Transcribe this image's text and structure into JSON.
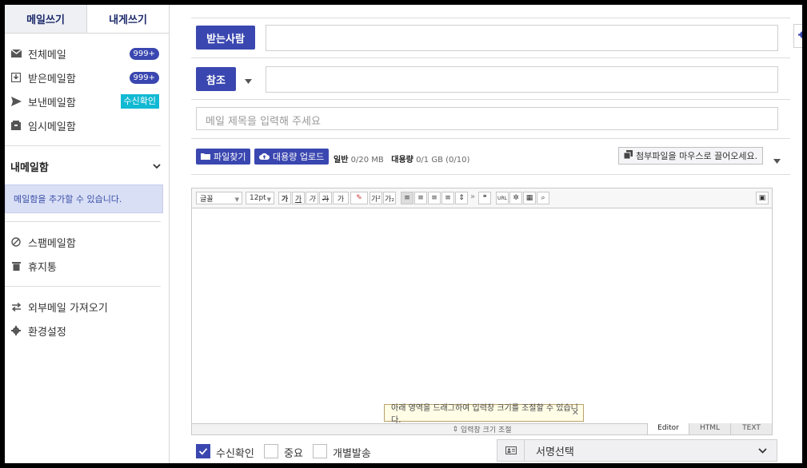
{
  "tabs": {
    "write": "메일쓰기",
    "self": "내게쓰기"
  },
  "nav": [
    {
      "label": "전체메일",
      "icon": "mail-icon",
      "badge": "999+"
    },
    {
      "label": "받은메일함",
      "icon": "inbox-icon",
      "badge": "999+"
    },
    {
      "label": "보낸메일함",
      "icon": "send-icon",
      "badge": "수신확인"
    },
    {
      "label": "임시메일함",
      "icon": "draft-icon",
      "badge": ""
    }
  ],
  "mybox": {
    "title": "내메일함",
    "hint": "메일함을 추가할 수 있습니다."
  },
  "nav2": [
    {
      "label": "스팸메일함",
      "icon": "spam-icon"
    },
    {
      "label": "휴지통",
      "icon": "trash-icon"
    }
  ],
  "nav3": [
    {
      "label": "외부메일 가져오기",
      "icon": "import-icon"
    },
    {
      "label": "환경설정",
      "icon": "gear-icon"
    }
  ],
  "compose": {
    "to_label": "받는사람",
    "to_value": "",
    "cc_label": "참조",
    "cc_value": "",
    "subject_placeholder": "메일 제목을 입력해 주세요",
    "attach_btn": "파일찾기",
    "bulk_btn": "대용량 업로드",
    "quota_normal_label": "일반",
    "quota_normal_value": "0/20 MB",
    "quota_bulk_label": "대용량",
    "quota_bulk_value": "0/1 GB (0/10)",
    "drop_hint": "첨부파일을 마우스로 끌어오세요."
  },
  "editor": {
    "font": "글꼴",
    "size": "12pt",
    "resize_tip": "아래 영역을 드래그하여 입력창 크기를 조절할 수 있습니다.",
    "resize_label": "입력창 크기 조절",
    "modes": [
      "Editor",
      "HTML",
      "TEXT"
    ]
  },
  "options": {
    "read_receipt": "수신확인",
    "important": "중요",
    "individual": "개별발송",
    "signature": "서명선택"
  },
  "colors": {
    "accent": "#3a47b0",
    "cyan": "#11b9d3"
  }
}
